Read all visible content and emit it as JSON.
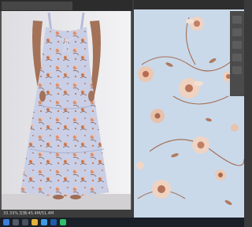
{
  "app": {
    "status_zoom": "33.33%",
    "status_info": "文档:45.4M/51.4M"
  },
  "colors": {
    "app_bg": "#3a3a3a",
    "pattern_bg": "#c9d9ea",
    "flower_peach": "#e7c1ad",
    "flower_brown": "#9a6a4f",
    "dress_base": "#c8cde6"
  },
  "taskbar": {
    "icons": [
      "windows-icon",
      "search-icon",
      "task-view-icon",
      "file-explorer-icon",
      "browser-icon",
      "photoshop-icon",
      "chat-icon"
    ]
  }
}
